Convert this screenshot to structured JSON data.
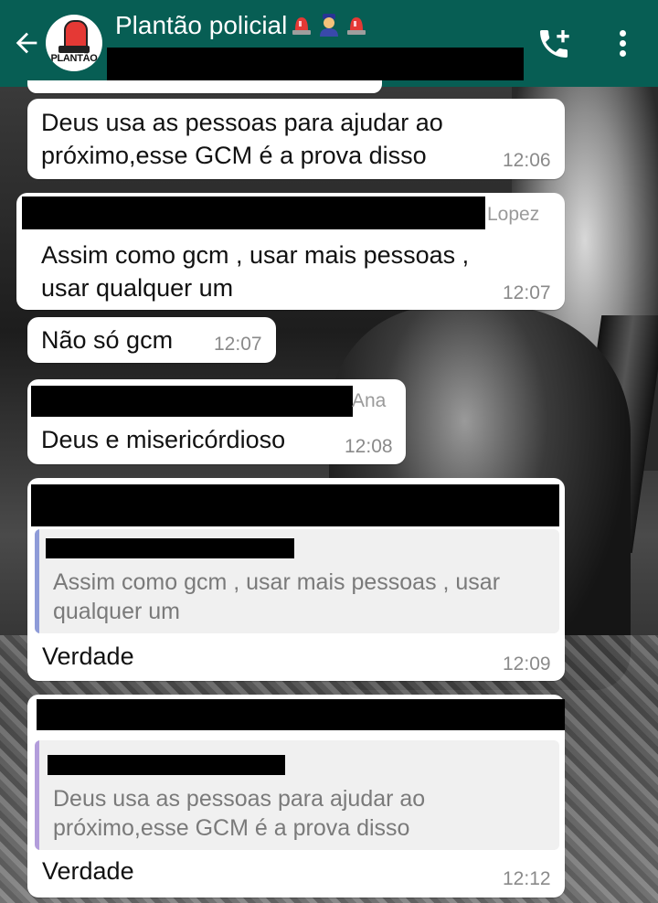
{
  "header": {
    "title": "Plantão policial",
    "avatar_text": "PLANTÃO",
    "title_emojis": [
      "siren-emoji",
      "police-officer-emoji",
      "siren-emoji"
    ],
    "background_color": "#075e54"
  },
  "messages": [
    {
      "sender": "",
      "text_lines": [
        "Deus usa as pessoas para ajudar ao",
        "próximo,esse GCM é a prova disso"
      ],
      "time": "12:06"
    },
    {
      "sender": "Lopez",
      "text_lines": [
        "Assim como gcm , usar mais pessoas ,",
        "usar qualquer um"
      ],
      "time": "12:07"
    },
    {
      "sender": "",
      "text_lines": [
        "Não só gcm"
      ],
      "time": "12:07"
    },
    {
      "sender": "Ana",
      "text_lines": [
        "Deus e misericórdioso"
      ],
      "time": "12:08"
    },
    {
      "sender": "",
      "quoted_lines": [
        "Assim como gcm , usar mais pessoas , usar",
        "qualquer um"
      ],
      "text": "Verdade",
      "time": "12:09",
      "quote_bar_color": "#8e9bd8"
    },
    {
      "sender": "",
      "quoted_lines": [
        "Deus usa as pessoas para ajudar ao",
        "próximo,esse GCM é a prova disso"
      ],
      "text": "Verdade",
      "time": "12:12",
      "quote_bar_color": "#b39ddb"
    }
  ]
}
